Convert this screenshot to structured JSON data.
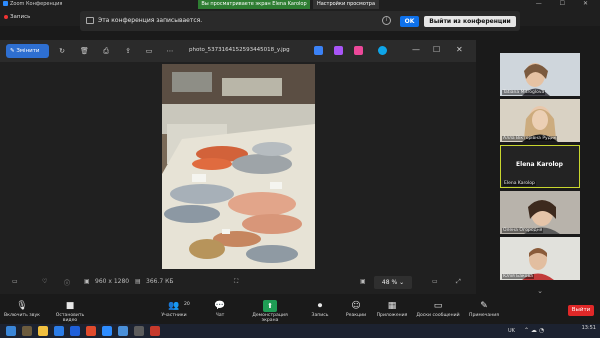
{
  "titlebar": {
    "app_title": "Zoom Конференция",
    "share_notice": "Вы просматриваете экран Elena Karolop",
    "view_settings": "Настройки просмотра"
  },
  "recording": {
    "label": "Запись",
    "banner_text": "Эта конференция записывается.",
    "ok": "OK",
    "leave": "Выйти из конференции"
  },
  "viewer": {
    "edit_label": "Змінити",
    "filename": "photo_5373164152593445018_y.jpg",
    "dimensions": "960 x 1280",
    "filesize": "366.7 КБ",
    "zoom": "48 %"
  },
  "participants": [
    {
      "name": "Tatiana Mitroglova"
    },
    {
      "name": "Алла Вікторівна Рудик"
    },
    {
      "name": "Elena Karolop",
      "active": true,
      "center_name": "Elena Karolop"
    },
    {
      "name": "Олена Огородня"
    },
    {
      "name": "Юлія Бакова"
    }
  ],
  "toolbar": {
    "audio": "Включить звук",
    "video": "Остановить видео",
    "participants": "Участники",
    "participants_count": "20",
    "chat": "Чат",
    "share": "Демонстрация экрана",
    "record": "Запись",
    "reactions": "Реакции",
    "apps": "Приложения",
    "whiteboard": "Доски сообщений",
    "notes": "Примечания",
    "exit": "Выйти"
  },
  "taskbar": {
    "lang": "UK",
    "time": "13:51"
  },
  "colors": {
    "accent_blue": "#0e71eb",
    "share_green": "#1f9d55",
    "exit_red": "#e02828",
    "active_speaker": "#c8d62e"
  }
}
